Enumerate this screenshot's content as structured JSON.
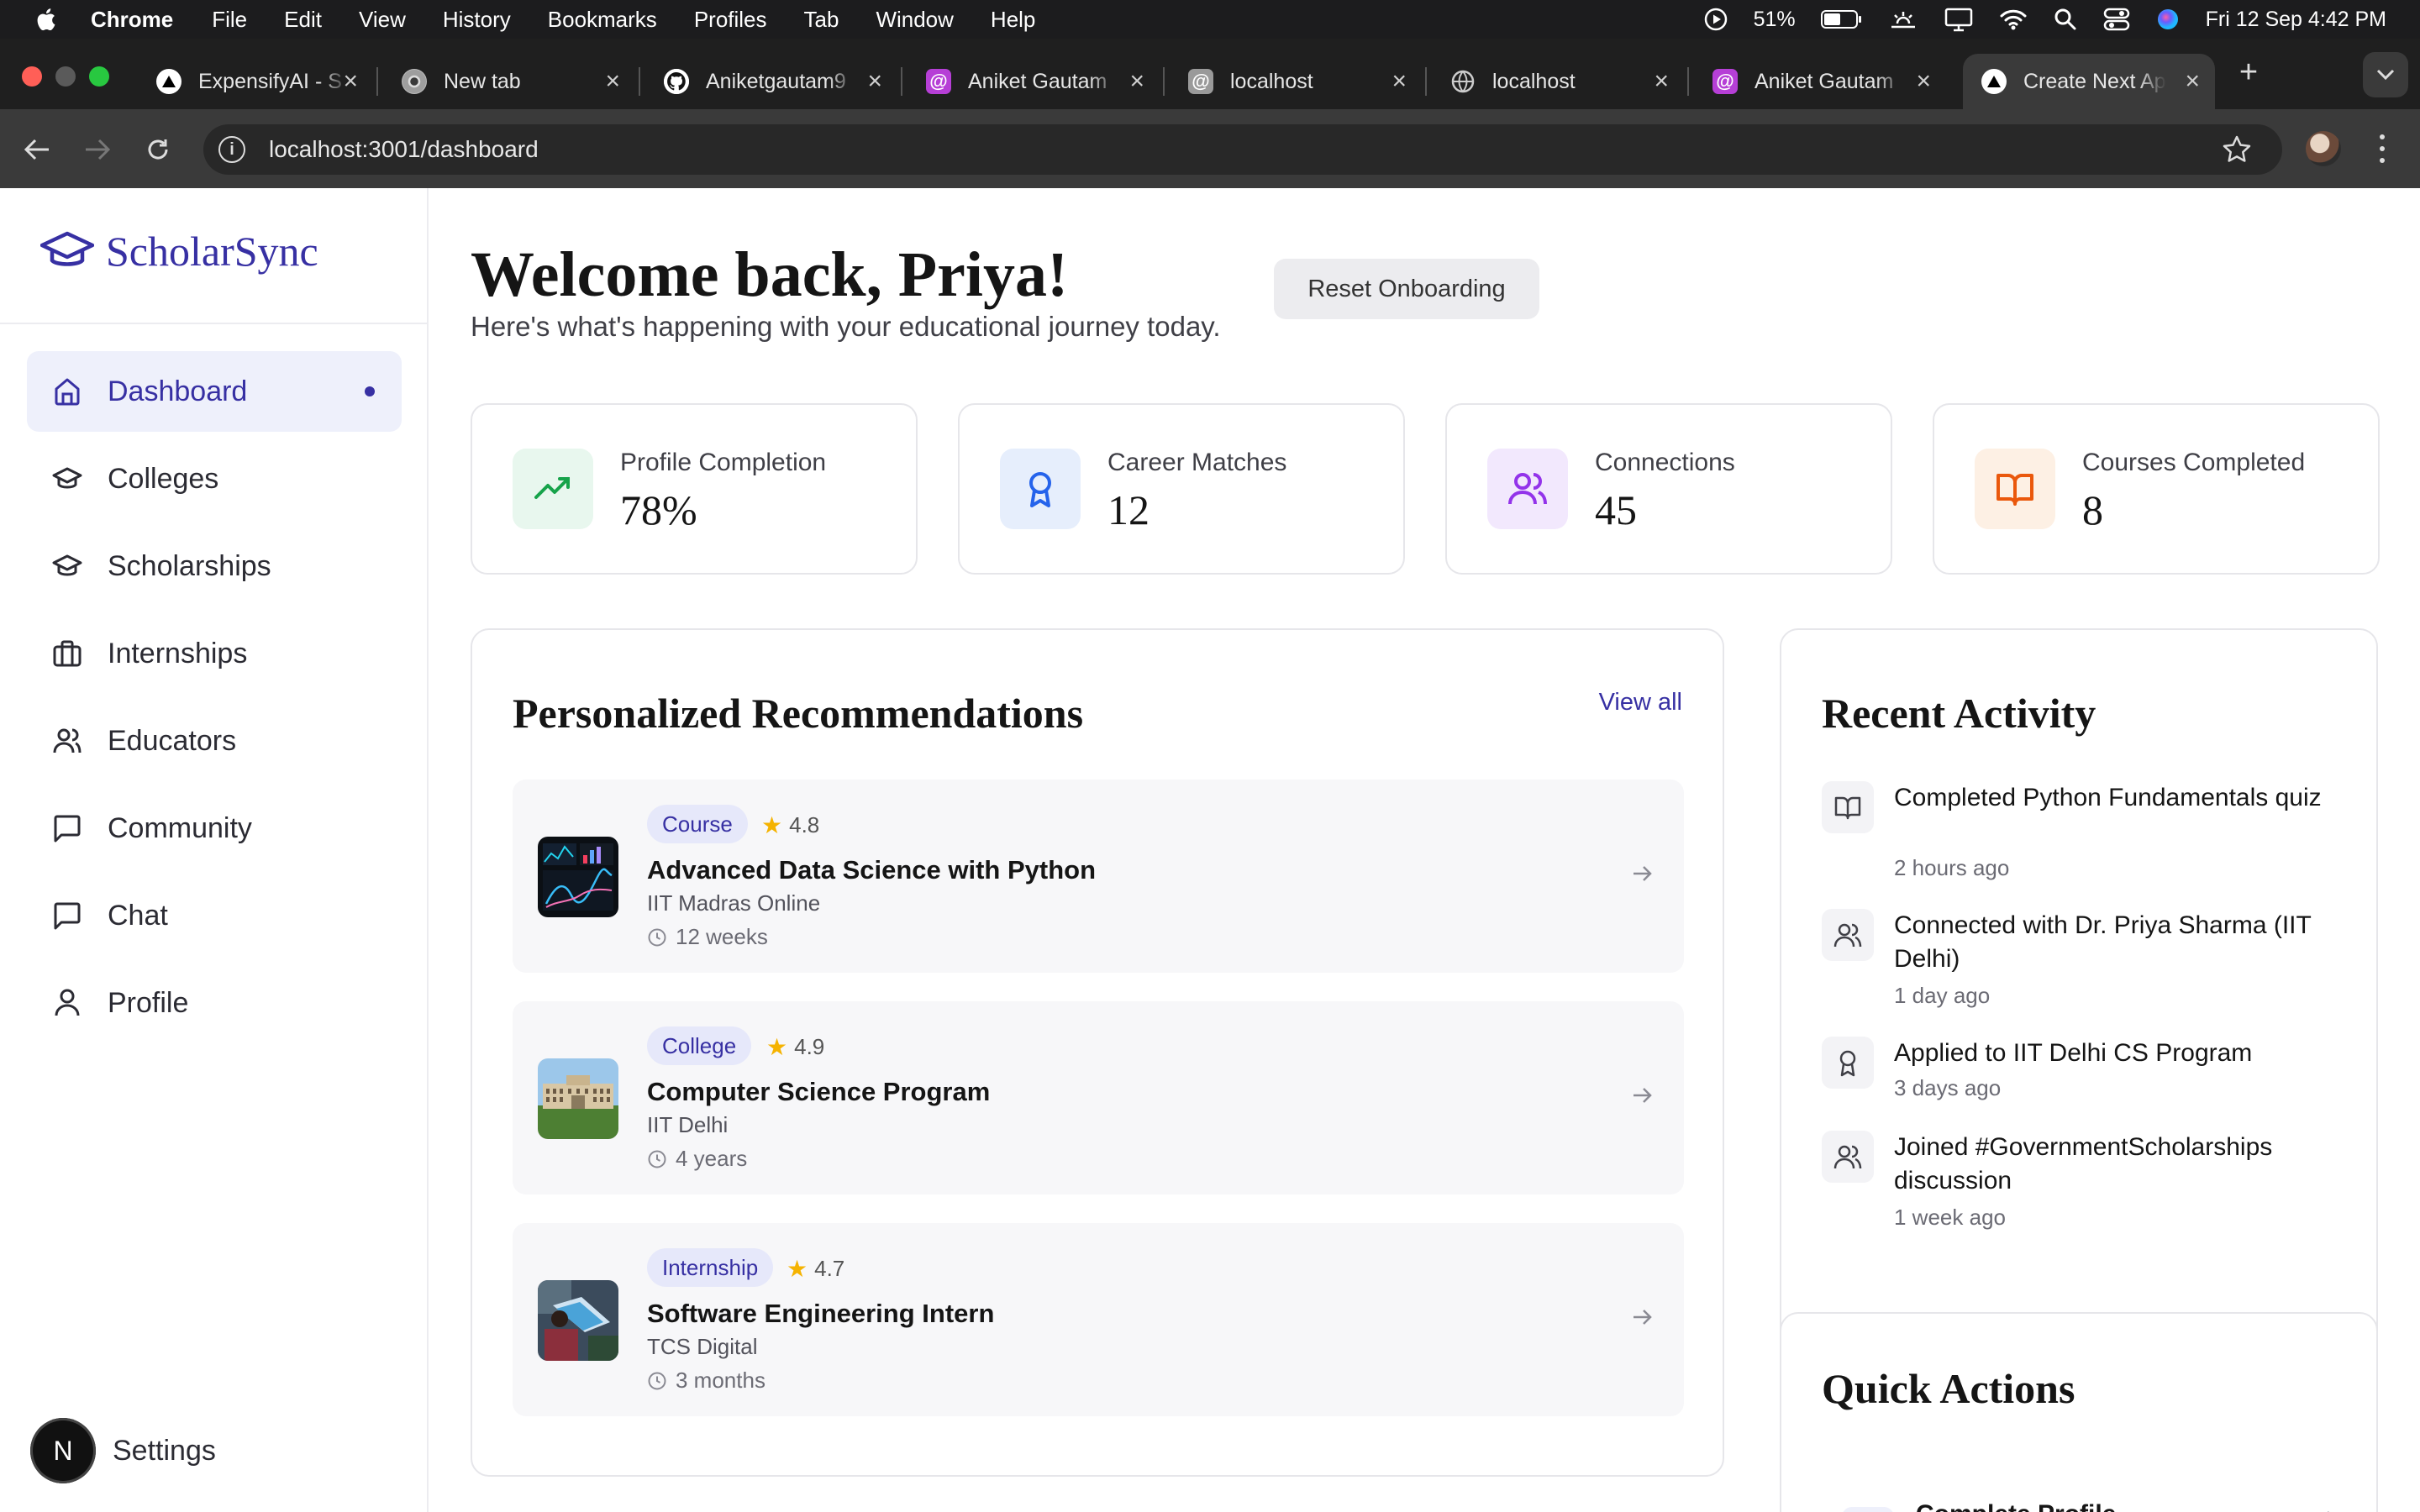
{
  "menubar": {
    "app": "Chrome",
    "items": [
      "File",
      "Edit",
      "View",
      "History",
      "Bookmarks",
      "Profiles",
      "Tab",
      "Window",
      "Help"
    ],
    "battery": "51%",
    "datetime": "Fri 12 Sep  4:42 PM"
  },
  "tabs": [
    {
      "title": "ExpensifyAI - S",
      "icon": "vercel-triangle-icon"
    },
    {
      "title": "New tab",
      "icon": "chrome-icon"
    },
    {
      "title": "Aniketgautam9",
      "icon": "github-icon"
    },
    {
      "title": "Aniket Gautam",
      "icon": "at-sign-icon"
    },
    {
      "title": "localhost",
      "icon": "at-sign-icon"
    },
    {
      "title": "localhost",
      "icon": "globe-icon"
    },
    {
      "title": "Aniket Gautam",
      "icon": "at-sign-icon"
    },
    {
      "title": "Create Next App",
      "icon": "vercel-triangle-icon",
      "active": true
    }
  ],
  "toolbar": {
    "url": "localhost:3001/dashboard"
  },
  "sidebar": {
    "brand": "ScholarSync",
    "items": [
      {
        "label": "Dashboard",
        "icon": "home-icon",
        "active": true
      },
      {
        "label": "Colleges",
        "icon": "graduation-cap-icon"
      },
      {
        "label": "Scholarships",
        "icon": "graduation-cap-icon"
      },
      {
        "label": "Internships",
        "icon": "briefcase-icon"
      },
      {
        "label": "Educators",
        "icon": "users-icon"
      },
      {
        "label": "Community",
        "icon": "message-square-icon"
      },
      {
        "label": "Chat",
        "icon": "message-square-icon"
      },
      {
        "label": "Profile",
        "icon": "user-icon"
      }
    ],
    "settings_badge": "N",
    "settings_label": "Settings"
  },
  "main": {
    "title": "Welcome back, Priya!",
    "subtitle": "Here's what's happening with your educational journey today.",
    "reset_label": "Reset Onboarding",
    "stats": [
      {
        "label": "Profile Completion",
        "value": "78%",
        "icon": "trending-up-icon",
        "color": "#16a34a",
        "bg": "#e8f7ee"
      },
      {
        "label": "Career Matches",
        "value": "12",
        "icon": "award-icon",
        "color": "#2563eb",
        "bg": "#e6eefc"
      },
      {
        "label": "Connections",
        "value": "45",
        "icon": "users-icon",
        "color": "#9333ea",
        "bg": "#f2e8fd"
      },
      {
        "label": "Courses Completed",
        "value": "8",
        "icon": "book-open-icon",
        "color": "#ea580c",
        "bg": "#fdf0e4"
      }
    ],
    "recommendations": {
      "title": "Personalized Recommendations",
      "view_all": "View all",
      "items": [
        {
          "type": "Course",
          "rating": "4.8",
          "title": "Advanced Data Science with Python",
          "org": "IIT Madras Online",
          "duration": "12 weeks"
        },
        {
          "type": "College",
          "rating": "4.9",
          "title": "Computer Science Program",
          "org": "IIT Delhi",
          "duration": "4 years"
        },
        {
          "type": "Internship",
          "rating": "4.7",
          "title": "Software Engineering Intern",
          "org": "TCS Digital",
          "duration": "3 months"
        }
      ]
    },
    "activity": {
      "title": "Recent Activity",
      "items": [
        {
          "text": "Completed Python Fundamentals quiz",
          "time": "2 hours ago",
          "icon": "book-open-icon"
        },
        {
          "text": "Connected with Dr. Priya Sharma (IIT Delhi)",
          "time": "1 day ago",
          "icon": "users-icon"
        },
        {
          "text": "Applied to IIT Delhi CS Program",
          "time": "3 days ago",
          "icon": "award-icon"
        },
        {
          "text": "Joined #GovernmentScholarships discussion",
          "time": "1 week ago",
          "icon": "users-icon"
        }
      ]
    },
    "quick_actions": {
      "title": "Quick Actions",
      "items": [
        {
          "label": "Complete Profile",
          "icon": "users-icon"
        }
      ]
    }
  }
}
